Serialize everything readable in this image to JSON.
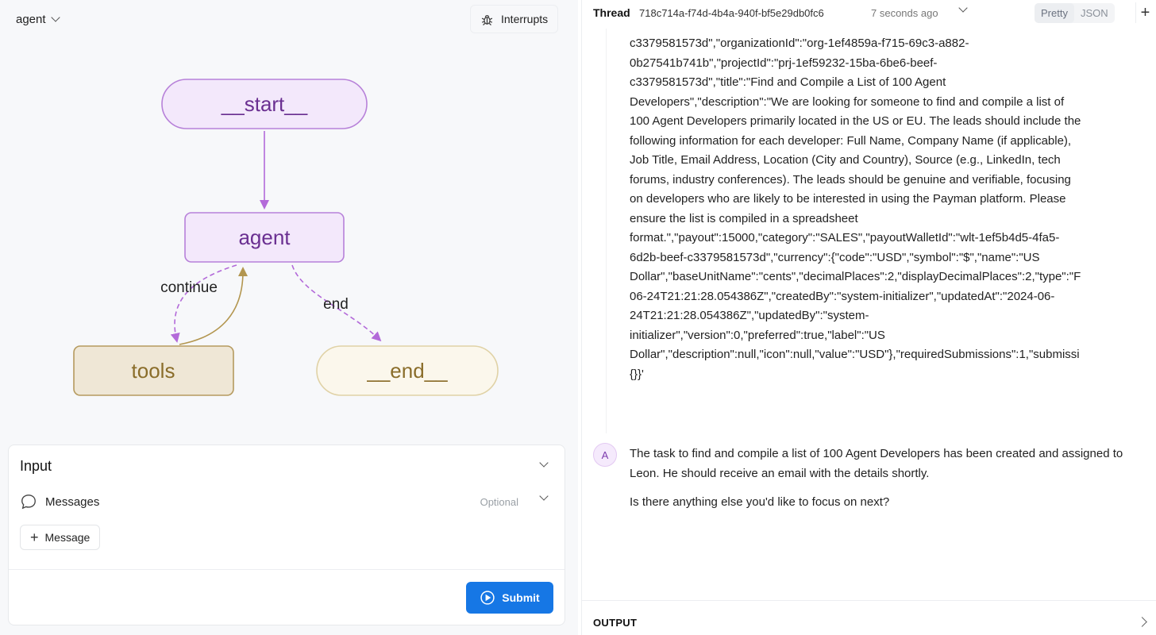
{
  "graph_select": {
    "value": "agent"
  },
  "interrupts": {
    "label": "Interrupts"
  },
  "graph": {
    "nodes": {
      "start": "__start__",
      "agent": "agent",
      "tools": "tools",
      "end": "__end__"
    },
    "edges": {
      "continue": "continue",
      "end": "end"
    },
    "colors": {
      "start_fill": "#f3e8fb",
      "start_stroke": "#b781d9",
      "tools_fill": "#efe7d6",
      "tools_stroke": "#b59a5e",
      "end_fill": "#fbf7ec",
      "end_stroke": "#e0d2a6",
      "purple_text": "#6a2f91",
      "gold_text": "#8a6d2a",
      "purple_edge": "#b36ad9",
      "gold_edge": "#b3964f"
    }
  },
  "input": {
    "title": "Input",
    "messages_label": "Messages",
    "optional": "Optional",
    "add_message": "Message",
    "submit": "Submit"
  },
  "thread": {
    "label": "Thread",
    "id": "718c714a-f74d-4b4a-940f-bf5e29db0fc6",
    "time": "7 seconds ago",
    "view_pretty": "Pretty",
    "view_json": "JSON"
  },
  "json_lines": [
    "c3379581573d\",\"organizationId\":\"org-1ef4859a-f715-69c3-a882-",
    "0b27541b741b\",\"projectId\":\"prj-1ef59232-15ba-6be6-beef-",
    "c3379581573d\",\"title\":\"Find and Compile a List of 100 Agent",
    "Developers\",\"description\":\"We are looking for someone to find and compile a list of",
    "100 Agent Developers primarily located in the US or EU. The leads should include the",
    "following information for each developer: Full Name, Company Name (if applicable),",
    "Job Title, Email Address, Location (City and Country), Source (e.g., LinkedIn, tech",
    "forums, industry conferences). The leads should be genuine and verifiable, focusing",
    "on developers who are likely to be interested in using the Payman platform. Please",
    "ensure the list is compiled in a spreadsheet",
    "format.\",\"payout\":15000,\"category\":\"SALES\",\"payoutWalletId\":\"wlt-1ef5b4d5-4fa5-",
    "6d2b-beef-c3379581573d\",\"currency\":{\"code\":\"USD\",\"symbol\":\"$\",\"name\":\"US",
    "Dollar\",\"baseUnitName\":\"cents\",\"decimalPlaces\":2,\"displayDecimalPlaces\":2,\"type\":\"F",
    "06-24T21:21:28.054386Z\",\"createdBy\":\"system-initializer\",\"updatedAt\":\"2024-06-",
    "24T21:21:28.054386Z\",\"updatedBy\":\"system-",
    "initializer\",\"version\":0,\"preferred\":true,\"label\":\"US",
    "Dollar\",\"description\":null,\"icon\":null,\"value\":\"USD\"},\"requiredSubmissions\":1,\"submissi",
    "{}}'"
  ],
  "assistant": {
    "avatar": "A",
    "message_1": "The task to find and compile a list of 100 Agent Developers has been created and assigned to Leon. He should receive an email with the details shortly.",
    "message_2": "Is there anything else you'd like to focus on next?"
  },
  "output": {
    "label": "OUTPUT"
  },
  "colors": {
    "submit_bg": "#1677e5",
    "left_bg": "#f7f8fa"
  },
  "icons": [
    "chevron-down-icon",
    "bug-icon",
    "chat-bubble-icon",
    "plus-icon",
    "play-circle-icon",
    "chevron-right-icon"
  ]
}
